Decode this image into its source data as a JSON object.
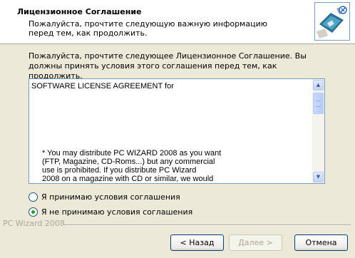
{
  "header": {
    "title": "Лицензионное Соглашение",
    "subtitle": "Пожалуйста, прочтите следующую важную информацию перед тем, как продолжить."
  },
  "intro_text": "Пожалуйста, прочтите следующее Лицензионное Соглашение. Вы должны принять условия этого соглашения перед тем, как продолжить.",
  "license": {
    "heading": "SOFTWARE LICENSE AGREEMENT for",
    "body": "* You may distribute PC WIZARD 2008 as you want\n(FTP, Magazine, CD-Roms...) but any commercial\nuse is prohibited. If you distribute PC Wizard\n2008 on a magazine with CD or similar, we would"
  },
  "options": {
    "accept_label": "Я принимаю условия соглашения",
    "decline_label": "Я не принимаю условия соглашения",
    "selected": "decline"
  },
  "brand_text": "PC Wizard 2008",
  "buttons": {
    "back": "< Назад",
    "next": "Далее >",
    "cancel": "Отмена"
  },
  "icons": {
    "logo": "pc-wizard-logo-icon",
    "scroll_up": "scroll-up-arrow-icon",
    "scroll_down": "scroll-down-arrow-icon"
  }
}
